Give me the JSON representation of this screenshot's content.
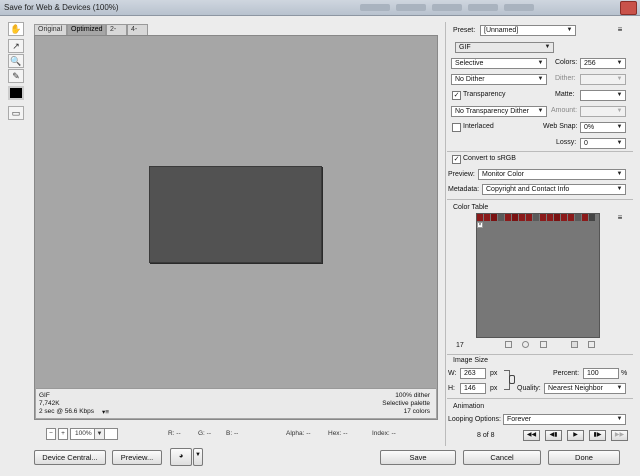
{
  "window": {
    "title": "Save for Web & Devices (100%)"
  },
  "tabs": [
    {
      "label": "Original"
    },
    {
      "label": "Optimized"
    },
    {
      "label": "2-Up"
    },
    {
      "label": "4-Up"
    }
  ],
  "info": {
    "format": "GIF",
    "size": "7,742K",
    "time": "2 sec @ 56.6 Kbps",
    "time_menu": "▾≡",
    "dither": "100% dither",
    "palette": "Selective palette",
    "colors": "17 colors"
  },
  "status": {
    "zoom": "100%",
    "r": "R: --",
    "g": "G: --",
    "b": "B: --",
    "alpha": "Alpha: --",
    "hex": "Hex: --",
    "index": "Index: --"
  },
  "buttons": {
    "device_central": "Device Central...",
    "preview": "Preview...",
    "save": "Save",
    "cancel": "Cancel",
    "done": "Done"
  },
  "panel": {
    "preset_label": "Preset:",
    "preset_value": "[Unnamed]",
    "format": "GIF",
    "reduction": "Selective",
    "colors_label": "Colors:",
    "colors_value": "256",
    "dither_method": "No Dither",
    "dither_label": "Dither:",
    "transparency": "Transparency",
    "matte_label": "Matte:",
    "trans_dither": "No Transparency Dither",
    "amount_label": "Amount:",
    "interlaced": "Interlaced",
    "websnap_label": "Web Snap:",
    "websnap_value": "0%",
    "lossy_label": "Lossy:",
    "lossy_value": "0",
    "srgb": "Convert to sRGB",
    "preview_label": "Preview:",
    "preview_value": "Monitor Color",
    "metadata_label": "Metadata:",
    "metadata_value": "Copyright and Contact Info",
    "color_table_title": "Color Table",
    "color_count": "17",
    "image_size_title": "Image Size",
    "w_label": "W:",
    "w_value": "263",
    "h_label": "H:",
    "h_value": "146",
    "px": "px",
    "percent_label": "Percent:",
    "percent_value": "100",
    "percent_unit": "%",
    "quality_label": "Quality:",
    "quality_value": "Nearest Neighbor",
    "animation_title": "Animation",
    "looping_label": "Looping Options:",
    "looping_value": "Forever",
    "frame_counter": "8 of 8"
  },
  "color_table": {
    "swatches": [
      "#8b1a1a",
      "#8b1a1a",
      "#7a1212",
      "#5a5a5a",
      "#8b1a1a",
      "#7a1212",
      "#8b1a1a",
      "#8b1a1a",
      "#5a5a5a",
      "#8b1a1a",
      "#8b1a1a",
      "#7a1212",
      "#8b1a1a",
      "#8b1a1a",
      "#5a5a5a",
      "#8b1a1a",
      "#444444"
    ]
  },
  "icons": {
    "hand": "hand-icon",
    "slice": "slice-select-icon",
    "zoom": "zoom-icon",
    "eyedropper": "eyedropper-icon",
    "color": "eyedropper-color-icon",
    "toggle_slices": "toggle-slices-icon"
  }
}
